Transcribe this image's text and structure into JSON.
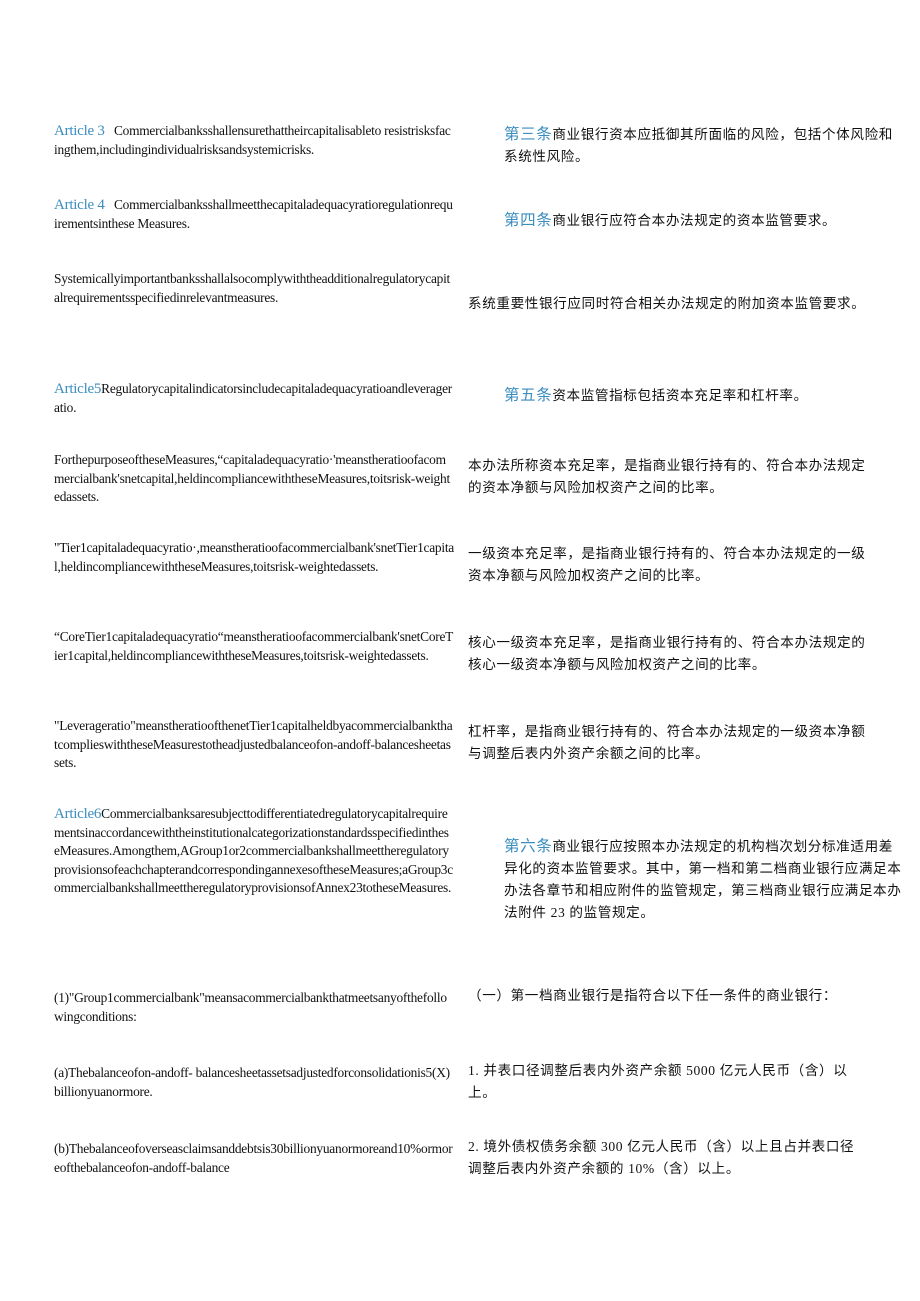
{
  "accent_color": "#3b8dc0",
  "rows": [
    {
      "en_label": "Article 3",
      "en_text": "Commercialbanksshallensurethattheircapitalisableto resistrisksfacingthem,includingindividualrisksandsystemicrisks.",
      "zh_label": "第三条",
      "zh_text": "商业银行资本应抵御其所面临的风险，包括个体风险和系统性风险。"
    },
    {
      "en_label": "Article 4",
      "en_text": "Commercialbanksshallmeetthecapitaladequacyratioregulationrequirementsinthese Measures.",
      "zh_label": "第四条",
      "zh_text": "商业银行应符合本办法规定的资本监管要求。"
    },
    {
      "en_text": "Systemicallyimportantbanksshallalsocomplywiththeadditionalregulatorycapitalrequirementsspecifiedinrelevantmeasures.",
      "zh_text": "系统重要性银行应同时符合相关办法规定的附加资本监管要求。"
    },
    {
      "en_label": "Article5",
      "en_text": "Regulatorycapitalindicatorsincludecapitaladequacyratioandleverageratio.",
      "zh_label": "第五条",
      "zh_text": "资本监管指标包括资本充足率和杠杆率。"
    },
    {
      "en_text": "ForthepurposeoftheseMeasures,“capitaladequacyratio·'meanstheratioofacommercialbank'snetcapital,heldincompliancewiththeseMeasures,toitsrisk-weightedassets.",
      "zh_text": "本办法所称资本充足率，是指商业银行持有的、符合本办法规定的资本净额与风险加权资产之间的比率。"
    },
    {
      "en_text": "\"Tier1capitaladequacyratio·,meanstheratioofacommercialbank'snetTier1capital,heldincompliancewiththeseMeasures,toitsrisk-weightedassets.",
      "zh_text": "一级资本充足率，是指商业银行持有的、符合本办法规定的一级资本净额与风险加权资产之间的比率。"
    },
    {
      "en_text": "“CoreTier1capitaladequacyratio“meanstheratioofacommercialbank'snetCoreTier1capital,heldincompliancewiththeseMeasures,toitsrisk-weightedassets.",
      "zh_text": "核心一级资本充足率，是指商业银行持有的、符合本办法规定的核心一级资本净额与风险加权资产之间的比率。"
    },
    {
      "en_text": "\"Leverageratio\"meanstheratioofthenetTier1capitalheldbyacommercialbankthatcomplieswiththeseMeasurestotheadjustedbalanceofon-andoff-balancesheetassets.",
      "zh_text": "杠杆率，是指商业银行持有的、符合本办法规定的一级资本净额与调整后表内外资产余额之间的比率。"
    },
    {
      "en_label": "Article6",
      "en_text": "CommercialbanksaresubjecttodifferentiatedregulatorycapitalrequirementsinaccordancewiththeinstitutionalcategorizationstandardsspecifiedintheseMeasures.Amongthem,AGroup1or2commercialbankshallmeettheregulatoryprovisionsofeachchapterandcorrespondingannexesoftheseMeasures;aGroup3commercialbankshallmeettheregulatoryprovisionsofAnnex23totheseMeasures.",
      "zh_label": "第六条",
      "zh_text": "商业银行应按照本办法规定的机构档次划分标准适用差异化的资本监管要求。其中，第一档和第二档商业银行应满足本办法各章节和相应附件的监管规定，第三档商业银行应满足本办法附件 23 的监管规定。"
    },
    {
      "en_text": "(1)\"Group1commercialbank\"meansacommercialbankthatmeetsanyofthefollowingconditions:",
      "zh_text": "（一）第一档商业银行是指符合以下任一条件的商业银行："
    },
    {
      "en_text": "(a)Thebalanceofon-andoff- balancesheetassetsadjustedforconsolidationis5(X)billionyuanormore.",
      "zh_text": "1. 并表口径调整后表内外资产余额 5000 亿元人民币（含）以上。"
    },
    {
      "en_text": "(b)Thebalanceofoverseasclaimsanddebtsis30billionyuanormoreand10%ormoreofthebalanceofon-andoff-balance",
      "zh_text": "2. 境外债权债务余额 300 亿元人民币（含）以上且占并表口径调整后表内外资产余额的 10%（含）以上。"
    }
  ]
}
